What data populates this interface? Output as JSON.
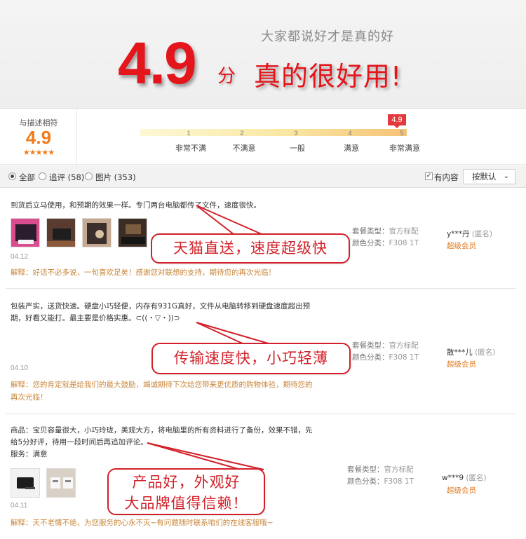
{
  "hero": {
    "tagline": "大家都说好才是真的好",
    "score": "4.9",
    "unit": "分",
    "slogan": "真的很好用!"
  },
  "summary": {
    "label": "与描述相符",
    "score": "4.9",
    "stars": "★★★★★",
    "marker": "4.9",
    "scale": [
      {
        "num": "1",
        "label": "非常不满"
      },
      {
        "num": "2",
        "label": "不满意"
      },
      {
        "num": "3",
        "label": "一般"
      },
      {
        "num": "4",
        "label": "满意"
      },
      {
        "num": "5",
        "label": "非常满意"
      }
    ]
  },
  "filter": {
    "all": "全部",
    "followup": "追评 (58)",
    "pictures": "图片 (353)",
    "has_content": "有内容",
    "sort": "按默认",
    "sort_icon": "chevron-down-icon"
  },
  "reviews": [
    {
      "text": "到货后立马使用，和预期的效果一样。专门两台电脑都传了文件，速度很快。",
      "date": "04.12",
      "reply": "解释：好话不必多说，一句喜欢足矣！感谢您对联想的支持，期待您的再次光临！",
      "package_label": "套餐类型：",
      "package_value": "官方标配",
      "color_label": "颜色分类：",
      "color_value": "F308 1T",
      "user": "y***丹",
      "anon": "(匿名)",
      "level": "超级会员",
      "callout": "天猫直送，速度超级快"
    },
    {
      "text_line1": "包装严实，送货快速。硬盘小巧轻便，内存有931G真好，文件从电脑转移到硬盘速度超出预",
      "text_line2": "期，好看又能打。最主要是价格实惠。⊂((・▽・))⊃",
      "date": "04.10",
      "reply_line1": "解释：您的肯定就是给我们的最大鼓励，竭诚期待下次给您带来更优质的购物体验，期待您的",
      "reply_line2": "再次光临！",
      "package_label": "套餐类型：",
      "package_value": "官方标配",
      "color_label": "颜色分类：",
      "color_value": "F308 1T",
      "user": "散***儿",
      "anon": "(匿名)",
      "level": "超级会员",
      "callout": "传输速度快，小巧轻薄"
    },
    {
      "text_line1": "商品：宝贝容量很大，小巧玲珑，美观大方，将电脑里的所有资料进行了备份，效果不错，先",
      "text_line2": "给5分好评，待用一段时间后再追加评论。",
      "text_line3": "服务：满意",
      "date": "04.11",
      "reply": "解释：天不老情不绝，为您服务的心永不灭~有问题随时联系咱们的在线客服哦~",
      "package_label": "套餐类型：",
      "package_value": "官方标配",
      "color_label": "颜色分类：",
      "color_value": "F308 1T",
      "user": "w***9",
      "anon": "(匿名)",
      "level": "超级会员",
      "callout_line1": "产品好，外观好",
      "callout_line2": "大品牌值得信赖！"
    }
  ]
}
